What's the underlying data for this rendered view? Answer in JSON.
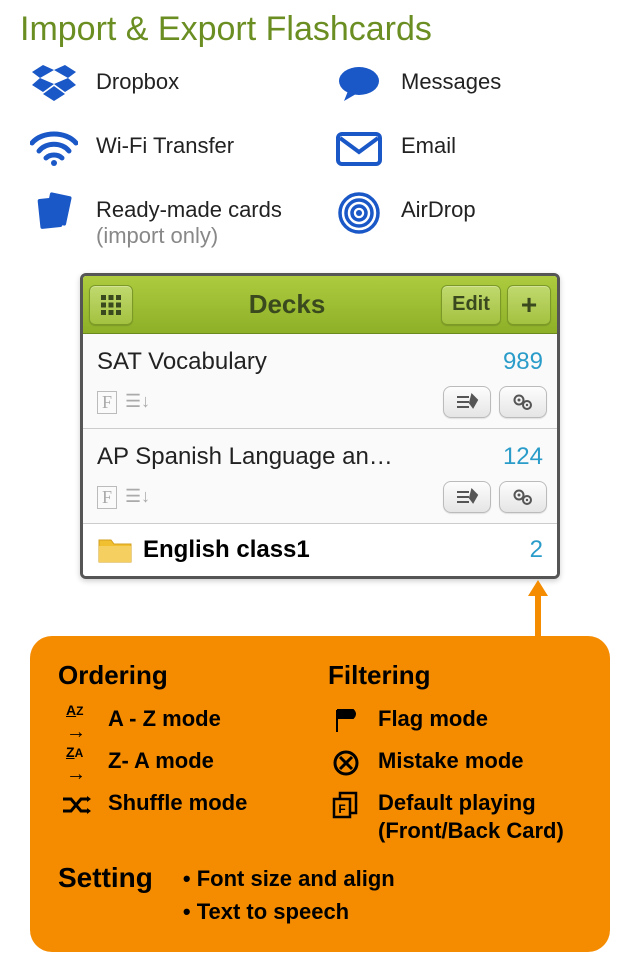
{
  "title": "Import & Export Flashcards",
  "services": {
    "left": [
      {
        "label": "Dropbox",
        "sub": ""
      },
      {
        "label": "Wi-Fi Transfer",
        "sub": ""
      },
      {
        "label": "Ready-made cards",
        "sub": "(import only)"
      }
    ],
    "right": [
      {
        "label": "Messages",
        "sub": ""
      },
      {
        "label": "Email",
        "sub": ""
      },
      {
        "label": "AirDrop",
        "sub": ""
      }
    ]
  },
  "nav": {
    "title": "Decks",
    "edit": "Edit"
  },
  "decks": [
    {
      "title": "SAT Vocabulary",
      "count": "989"
    },
    {
      "title": "AP Spanish Language an…",
      "count": "124"
    }
  ],
  "folder": {
    "name": "English class1",
    "count": "2"
  },
  "callout": {
    "ordering": {
      "head": "Ordering",
      "items": [
        "A - Z mode",
        "Z- A mode",
        "Shuffle mode"
      ]
    },
    "filtering": {
      "head": "Filtering",
      "items": [
        "Flag mode",
        "Mistake mode",
        "Default playing (Front/Back Card)"
      ]
    },
    "setting": {
      "head": "Setting",
      "bullets": [
        "• Font size and align",
        "• Text to speech"
      ]
    }
  }
}
